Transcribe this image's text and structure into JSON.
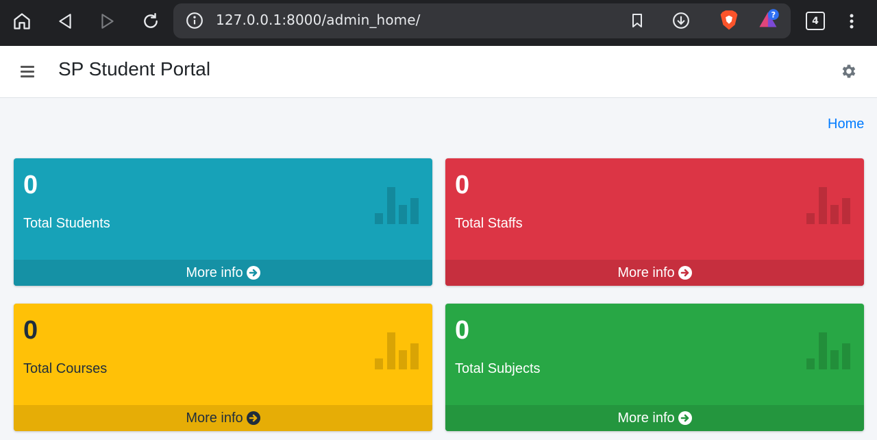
{
  "browser": {
    "url": "127.0.0.1:8000/admin_home/",
    "tab_count": "4",
    "icons": [
      "home-icon",
      "back-icon",
      "forward-icon",
      "reload-icon",
      "site-info-icon",
      "bookmark-icon",
      "download-icon",
      "brave-shield-icon",
      "brave-rewards-icon",
      "tabs-icon",
      "menu-icon"
    ]
  },
  "header": {
    "title": "SP Student Portal"
  },
  "breadcrumb": {
    "home": "Home"
  },
  "cards": [
    {
      "count": "0",
      "label": "Total Students",
      "link": "More info",
      "color": "#17a2b8"
    },
    {
      "count": "0",
      "label": "Total Staffs",
      "link": "More info",
      "color": "#dc3545"
    },
    {
      "count": "0",
      "label": "Total Courses",
      "link": "More info",
      "color": "#ffc107"
    },
    {
      "count": "0",
      "label": "Total Subjects",
      "link": "More info",
      "color": "#28a745"
    }
  ]
}
